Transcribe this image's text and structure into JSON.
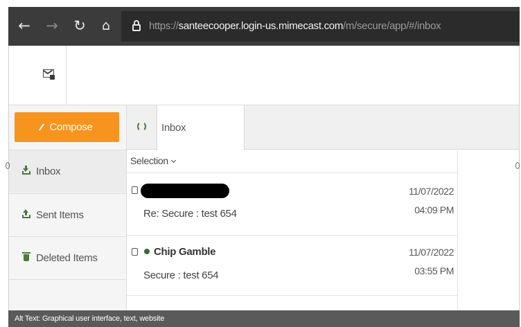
{
  "browser": {
    "back_icon": "arrow-left-icon",
    "forward_icon": "arrow-right-icon",
    "refresh_icon": "refresh-icon",
    "home_icon": "home-icon",
    "lock_icon": "lock-icon",
    "url_scheme": "https://",
    "url_host": "santeecooper.login-us.mimecast.com",
    "url_path": "/m/secure/app/#/inbox"
  },
  "header": {
    "logo_icon": "secure-mail-icon"
  },
  "sidebar": {
    "compose_label": "Compose",
    "items": [
      {
        "label": "Inbox",
        "icon": "inbox-download-icon",
        "active": true
      },
      {
        "label": "Sent Items",
        "icon": "sent-upload-icon",
        "active": false
      },
      {
        "label": "Deleted Items",
        "icon": "trash-icon",
        "active": false
      }
    ]
  },
  "tabs": {
    "refresh_icon": "refresh-icon",
    "active_tab": "Inbox"
  },
  "list": {
    "selection_label": "Selection",
    "messages": [
      {
        "sender": "",
        "sender_redacted": true,
        "unread": false,
        "subject": "Re: Secure : test 654",
        "date": "11/07/2022",
        "time": "04:09 PM"
      },
      {
        "sender": "Chip Gamble",
        "sender_redacted": false,
        "unread": true,
        "subject": "Secure : test 654",
        "date": "11/07/2022",
        "time": "03:55 PM"
      }
    ]
  },
  "footer": {
    "alt_text": "Alt Text: Graphical user interface, text, website"
  },
  "colors": {
    "accent": "#f7941d",
    "icon_green": "#4a7a3a",
    "browser_bar": "#3b3b3b"
  }
}
